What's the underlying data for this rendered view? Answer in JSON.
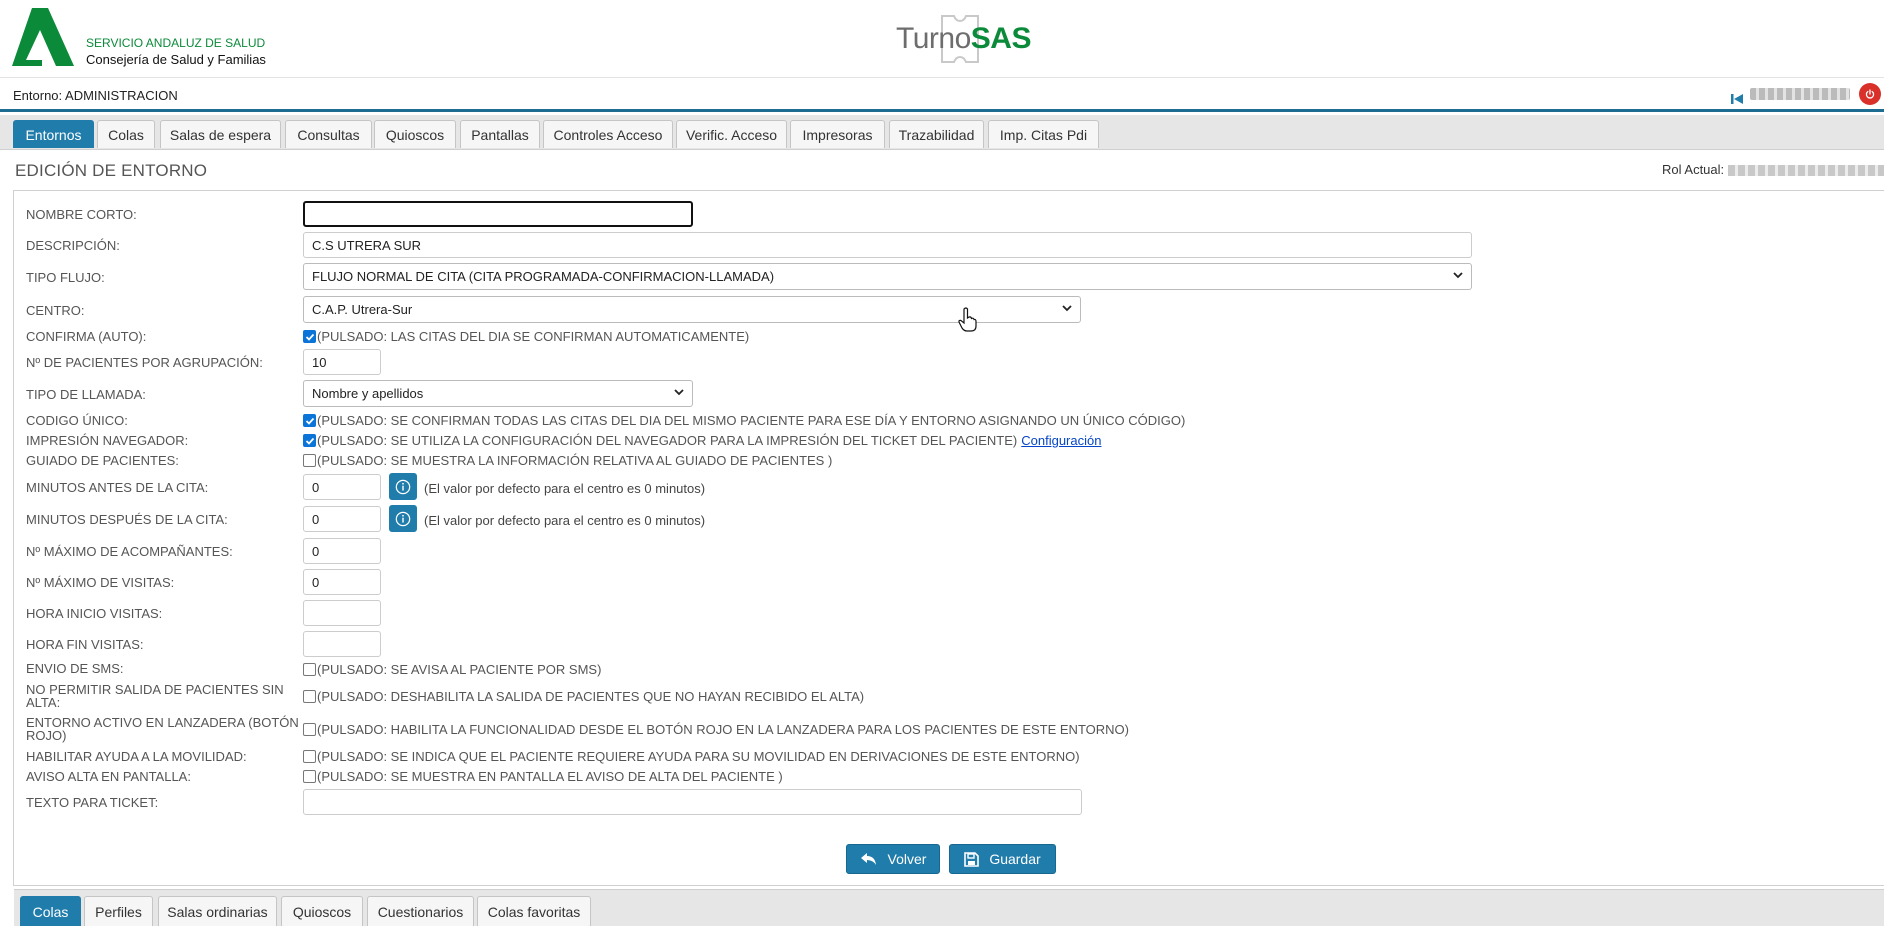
{
  "header": {
    "org_line1": "SERVICIO ANDALUZ DE SALUD",
    "org_line2": "Consejería de Salud y Familias",
    "app_name_a": "Turno",
    "app_name_b": "SAS",
    "environment": "Entorno: ADMINISTRACION",
    "colors": {
      "brand_green": "#0b8a3a",
      "accent_blue": "#1f7cab",
      "power_red": "#d9302a"
    }
  },
  "main_tabs": [
    {
      "label": "Entornos",
      "active": true
    },
    {
      "label": "Colas"
    },
    {
      "label": "Salas de espera"
    },
    {
      "label": "Consultas"
    },
    {
      "label": "Quioscos"
    },
    {
      "label": "Pantallas"
    },
    {
      "label": "Controles Acceso"
    },
    {
      "label": "Verific. Acceso"
    },
    {
      "label": "Impresoras"
    },
    {
      "label": "Trazabilidad"
    },
    {
      "label": "Imp. Citas Pdi"
    }
  ],
  "page": {
    "title": "EDICIÓN DE ENTORNO",
    "rol_label": "Rol Actual:"
  },
  "form": {
    "nombre_corto": {
      "label": "NOMBRE CORTO:",
      "value": ""
    },
    "descripcion": {
      "label": "DESCRIPCIÓN:",
      "value": "C.S UTRERA SUR"
    },
    "tipo_flujo": {
      "label": "TIPO FLUJO:",
      "value": "FLUJO NORMAL DE CITA (CITA PROGRAMADA-CONFIRMACION-LLAMADA)"
    },
    "centro": {
      "label": "CENTRO:",
      "value": "C.A.P. Utrera-Sur"
    },
    "confirma": {
      "label": "CONFIRMA (AUTO):",
      "checked": true,
      "text": "(PULSADO: LAS CITAS DEL DIA SE CONFIRMAN AUTOMATICAMENTE)"
    },
    "pacientes_agrupacion": {
      "label": "Nº DE PACIENTES POR AGRUPACIÓN:",
      "value": "10"
    },
    "tipo_llamada": {
      "label": "TIPO DE LLAMADA:",
      "value": "Nombre y apellidos"
    },
    "codigo_unico": {
      "label": "CODIGO ÚNICO:",
      "checked": true,
      "text": "(PULSADO: SE CONFIRMAN TODAS LAS CITAS DEL DIA DEL MISMO PACIENTE PARA ESE DÍA Y ENTORNO ASIGNANDO UN ÚNICO CÓDIGO)"
    },
    "impresion": {
      "label": "IMPRESIÓN NAVEGADOR:",
      "checked": true,
      "text": "(PULSADO: SE UTILIZA LA CONFIGURACIÓN DEL NAVEGADOR PARA LA IMPRESIÓN DEL TICKET DEL PACIENTE)",
      "link": "Configuración"
    },
    "guiado": {
      "label": "GUIADO DE PACIENTES:",
      "checked": false,
      "text": "(PULSADO: SE MUESTRA LA INFORMACIÓN RELATIVA AL GUIADO DE PACIENTES )"
    },
    "minutos_antes": {
      "label": "MINUTOS ANTES DE LA CITA:",
      "value": "0",
      "hint": "(El valor por defecto para el centro es 0 minutos)"
    },
    "minutos_despues": {
      "label": "MINUTOS DESPUÉS DE LA CITA:",
      "value": "0",
      "hint": "(El valor por defecto para el centro es 0 minutos)"
    },
    "max_acompanantes": {
      "label": "Nº MÁXIMO DE ACOMPAÑANTES:",
      "value": "0"
    },
    "max_visitas": {
      "label": "Nº MÁXIMO DE VISITAS:",
      "value": "0"
    },
    "hora_inicio": {
      "label": "HORA INICIO VISITAS:",
      "value": ""
    },
    "hora_fin": {
      "label": "HORA FIN VISITAS:",
      "value": ""
    },
    "envio_sms": {
      "label": "ENVIO DE SMS:",
      "checked": false,
      "text": "(PULSADO: SE AVISA AL PACIENTE POR SMS)"
    },
    "no_salida": {
      "label_line1": "NO PERMITIR SALIDA DE PACIENTES SIN",
      "label_line2": "ALTA:",
      "checked": false,
      "text": "(PULSADO: DESHABILITA LA SALIDA DE PACIENTES QUE NO HAYAN RECIBIDO EL ALTA)"
    },
    "lanzadera": {
      "label_line1": "ENTORNO ACTIVO EN LANZADERA (BOTÓN",
      "label_line2": "ROJO)",
      "checked": false,
      "text": "(PULSADO: HABILITA LA FUNCIONALIDAD DESDE EL BOTÓN ROJO EN LA LANZADERA PARA LOS PACIENTES DE ESTE ENTORNO)"
    },
    "movilidad": {
      "label": "HABILITAR AYUDA A LA MOVILIDAD:",
      "checked": false,
      "text": "(PULSADO: SE INDICA QUE EL PACIENTE REQUIERE AYUDA PARA SU MOVILIDAD EN DERIVACIONES DE ESTE ENTORNO)"
    },
    "aviso_alta": {
      "label": "AVISO ALTA EN PANTALLA:",
      "checked": false,
      "text": "(PULSADO: SE MUESTRA EN PANTALLA EL AVISO DE ALTA DEL PACIENTE )"
    },
    "texto_ticket": {
      "label": "TEXTO PARA TICKET:",
      "value": ""
    }
  },
  "actions": {
    "back_label": "Volver",
    "save_label": "Guardar"
  },
  "sub_tabs": [
    {
      "label": "Colas",
      "active": true
    },
    {
      "label": "Perfiles"
    },
    {
      "label": "Salas ordinarias"
    },
    {
      "label": "Quioscos"
    },
    {
      "label": "Cuestionarios"
    },
    {
      "label": "Colas favoritas"
    }
  ]
}
